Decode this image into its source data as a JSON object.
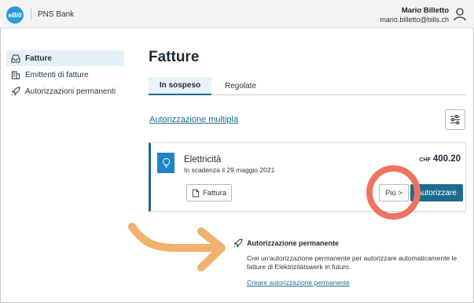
{
  "header": {
    "logo_text": "eBill",
    "bank_name": "PNS Bank",
    "user_name": "Mario Billetto",
    "user_email": "mario.billetto@bills.ch"
  },
  "sidebar": {
    "items": [
      {
        "label": "Fatture",
        "icon": "inbox-icon",
        "active": true
      },
      {
        "label": "Emittenti di fatture",
        "icon": "building-icon",
        "active": false
      },
      {
        "label": "Autorizzazioni permanenti",
        "icon": "rocket-icon",
        "active": false
      }
    ]
  },
  "main": {
    "title": "Fatture",
    "tabs": [
      {
        "label": "In sospeso",
        "active": true
      },
      {
        "label": "Regolate",
        "active": false
      }
    ],
    "multi_auth_link": "Autorizzazione multipla"
  },
  "invoice": {
    "name": "Elettricità",
    "due": "In scadenza il 29 maggio 2021",
    "currency": "CHF",
    "amount": "400.20",
    "invoice_button": "Fattura",
    "more_button": "Più >",
    "authorize_button": "Autorizzare"
  },
  "permanent": {
    "title": "Autorizzazione permanente",
    "description": "Crei un'autorizzazione permanente per autorizzare automaticamente le fatture di Elektrizitätswerk in futuro.",
    "link": "Creare autorizzazione permanente"
  },
  "colors": {
    "accent": "#1e6c8f",
    "logo": "#2a9bd6",
    "highlight": "#ee7462",
    "arrow": "#f0b26e"
  }
}
